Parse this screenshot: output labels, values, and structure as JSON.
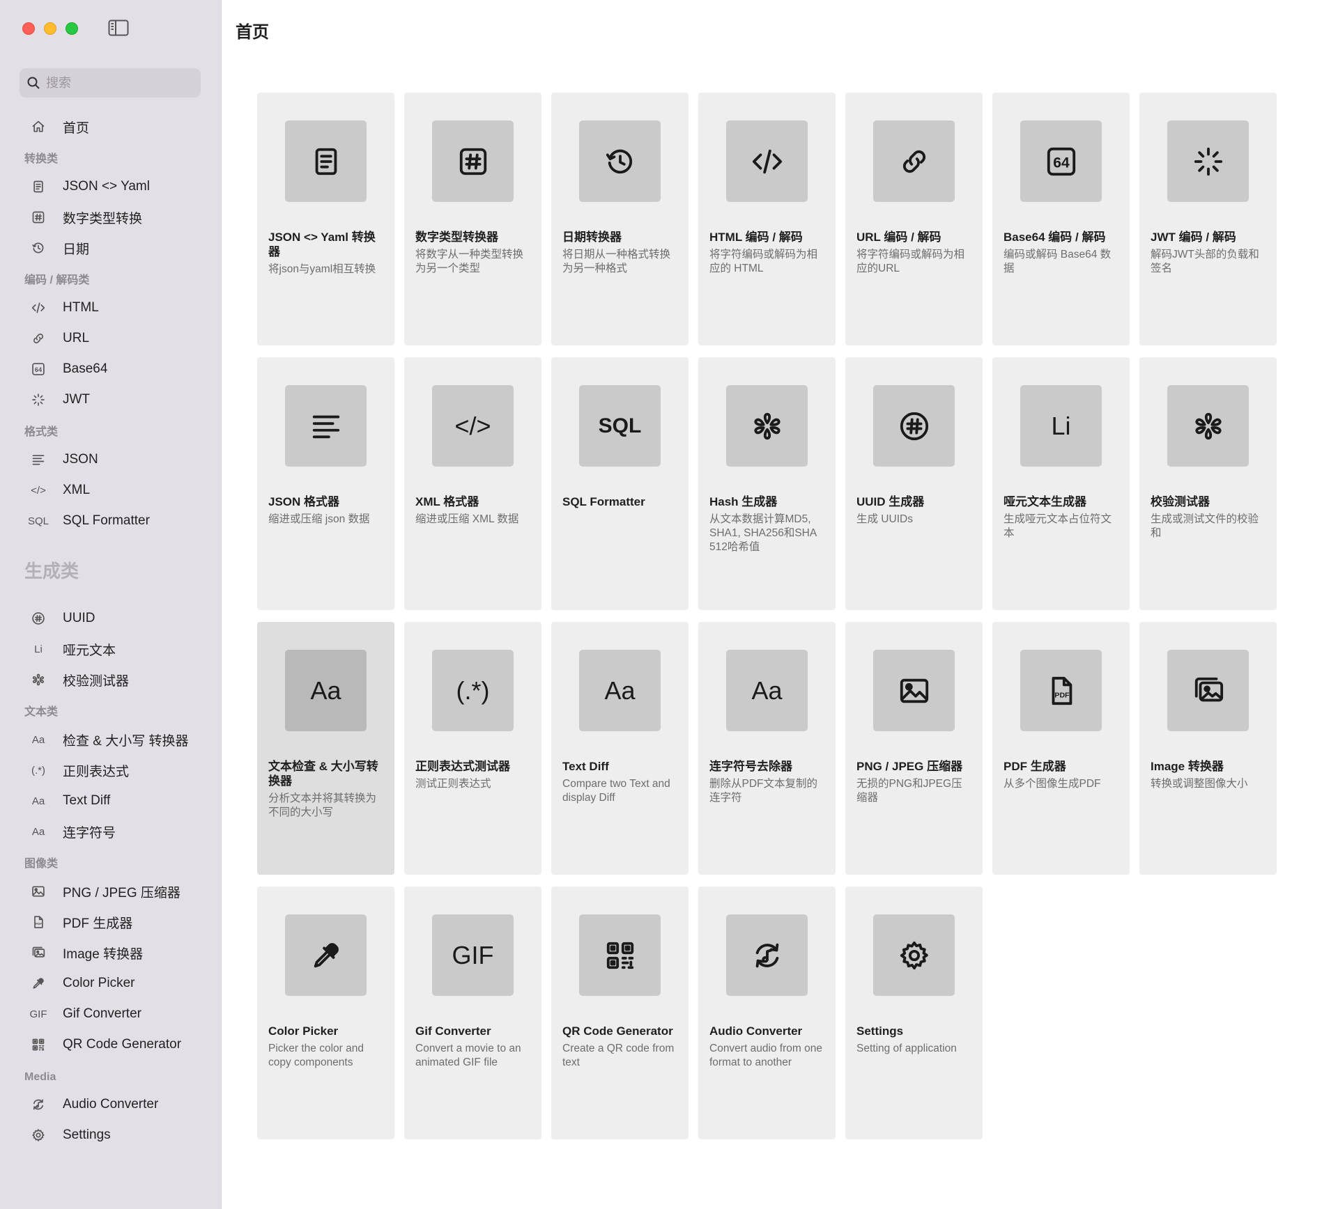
{
  "search": {
    "placeholder": "搜索"
  },
  "page_title": "首页",
  "sidebar": {
    "items": [
      {
        "type": "item",
        "icon": "home-icon",
        "label": "首页"
      },
      {
        "type": "section",
        "label": "转换类"
      },
      {
        "type": "item",
        "icon": "document-icon",
        "label": "JSON <> Yaml"
      },
      {
        "type": "item",
        "icon": "number-icon",
        "label": "数字类型转换"
      },
      {
        "type": "item",
        "icon": "history-icon",
        "label": "日期"
      },
      {
        "type": "section",
        "label": "编码 / 解码类"
      },
      {
        "type": "item",
        "icon": "code-icon",
        "label": "HTML"
      },
      {
        "type": "item",
        "icon": "link-icon",
        "label": "URL"
      },
      {
        "type": "item",
        "icon": "base64-icon",
        "label": "Base64"
      },
      {
        "type": "item",
        "icon": "spinner-icon",
        "label": "JWT"
      },
      {
        "type": "section",
        "label": "格式类"
      },
      {
        "type": "item",
        "icon": "lines-icon",
        "label": "JSON"
      },
      {
        "type": "item",
        "icon": "code-text-icon",
        "icon_text": "</>",
        "label": "XML"
      },
      {
        "type": "item",
        "icon": "sql-icon",
        "icon_text": "SQL",
        "label": "SQL Formatter"
      },
      {
        "type": "section_big",
        "label": "生成类"
      },
      {
        "type": "item",
        "icon": "uuid-icon",
        "label": "UUID"
      },
      {
        "type": "item",
        "icon": "lorem-icon",
        "icon_text": "Li",
        "label": "哑元文本"
      },
      {
        "type": "item",
        "icon": "checksum-icon",
        "label": "校验测试器"
      },
      {
        "type": "section",
        "label": "文本类"
      },
      {
        "type": "item",
        "icon": "text-case-icon",
        "icon_text": "Aa",
        "label": "检查 & 大小写 转换器"
      },
      {
        "type": "item",
        "icon": "regex-icon",
        "icon_text": "(.*)",
        "label": "正则表达式"
      },
      {
        "type": "item",
        "icon": "text-diff-icon",
        "icon_text": "Aa",
        "label": "Text Diff"
      },
      {
        "type": "item",
        "icon": "hyphen-icon",
        "icon_text": "Aa",
        "label": "连字符号"
      },
      {
        "type": "section",
        "label": "图像类"
      },
      {
        "type": "item",
        "icon": "image-icon",
        "label": "PNG / JPEG 压缩器"
      },
      {
        "type": "item",
        "icon": "pdf-icon",
        "label": "PDF 生成器"
      },
      {
        "type": "item",
        "icon": "images-icon",
        "label": "Image 转换器"
      },
      {
        "type": "item",
        "icon": "eyedropper-icon",
        "label": "Color Picker"
      },
      {
        "type": "item",
        "icon": "gif-icon",
        "icon_text": "GIF",
        "label": "Gif Converter"
      },
      {
        "type": "item",
        "icon": "qr-icon",
        "label": "QR Code Generator"
      },
      {
        "type": "section",
        "label": "Media"
      },
      {
        "type": "item",
        "icon": "audio-icon",
        "label": "Audio Converter"
      },
      {
        "type": "item",
        "icon": "gear-icon",
        "label": "Settings"
      }
    ]
  },
  "cards": [
    {
      "icon": "document-icon",
      "title": "JSON <> Yaml 转换器",
      "desc": "将json与yaml相互转换"
    },
    {
      "icon": "number-icon",
      "title": "数字类型转换器",
      "desc": "将数字从一种类型转换为另一个类型"
    },
    {
      "icon": "history-icon",
      "title": "日期转换器",
      "desc": "将日期从一种格式转换为另一种格式"
    },
    {
      "icon": "code-icon",
      "title": "HTML 编码 / 解码",
      "desc": "将字符编码或解码为相应的 HTML"
    },
    {
      "icon": "link-icon",
      "title": "URL 编码 / 解码",
      "desc": "将字符编码或解码为相应的URL"
    },
    {
      "icon": "base64-icon",
      "title": "Base64 编码 / 解码",
      "desc": "编码或解码 Base64 数据"
    },
    {
      "icon": "spinner-icon",
      "title": "JWT 编码 / 解码",
      "desc": "解码JWT头部的负载和签名"
    },
    {
      "icon": "lines-icon",
      "title": "JSON 格式器",
      "desc": "缩进或压缩 json 数据"
    },
    {
      "icon": "code-text-icon",
      "icon_text": "</>",
      "title": "XML 格式器",
      "desc": "缩进或压缩 XML 数据"
    },
    {
      "icon": "sql-icon",
      "icon_text": "SQL",
      "title": "SQL Formatter",
      "desc": ""
    },
    {
      "icon": "hash-icon",
      "title": "Hash 生成器",
      "desc": "从文本数据计算MD5, SHA1, SHA256和SHA 512哈希值"
    },
    {
      "icon": "uuid-icon",
      "title": "UUID 生成器",
      "desc": "生成 UUIDs"
    },
    {
      "icon": "lorem-icon",
      "icon_text": "Li",
      "title": "哑元文本生成器",
      "desc": "生成哑元文本占位符文本"
    },
    {
      "icon": "checksum-icon",
      "title": "校验测试器",
      "desc": "生成或测试文件的校验和"
    },
    {
      "icon": "text-case-icon",
      "icon_text": "Aa",
      "title": "文本检查 & 大小写转换器",
      "desc": "分析文本并将其转换为不同的大小写",
      "selected": true
    },
    {
      "icon": "regex-icon",
      "icon_text": "(.*)",
      "title": "正则表达式测试器",
      "desc": "测试正则表达式"
    },
    {
      "icon": "text-diff-icon",
      "icon_text": "Aa",
      "title": "Text Diff",
      "desc": "Compare two Text and display Diff"
    },
    {
      "icon": "hyphen-icon",
      "icon_text": "Aa",
      "title": "连字符号去除器",
      "desc": "删除从PDF文本复制的连字符"
    },
    {
      "icon": "image-icon",
      "title": "PNG / JPEG 压缩器",
      "desc": "无损的PNG和JPEG压缩器"
    },
    {
      "icon": "pdf-icon",
      "title": "PDF 生成器",
      "desc": "从多个图像生成PDF"
    },
    {
      "icon": "images-icon",
      "title": "Image 转换器",
      "desc": "转换或调整图像大小"
    },
    {
      "icon": "eyedropper-icon",
      "title": "Color Picker",
      "desc": "Picker the color and copy components"
    },
    {
      "icon": "gif-icon",
      "icon_text": "GIF",
      "title": "Gif Converter",
      "desc": "Convert a movie to an animated GIF file"
    },
    {
      "icon": "qr-icon",
      "title": "QR Code Generator",
      "desc": "Create a QR code from text"
    },
    {
      "icon": "audio-icon",
      "title": "Audio Converter",
      "desc": "Convert audio from one format to another"
    },
    {
      "icon": "gear-icon",
      "title": "Settings",
      "desc": "Setting of application"
    }
  ]
}
